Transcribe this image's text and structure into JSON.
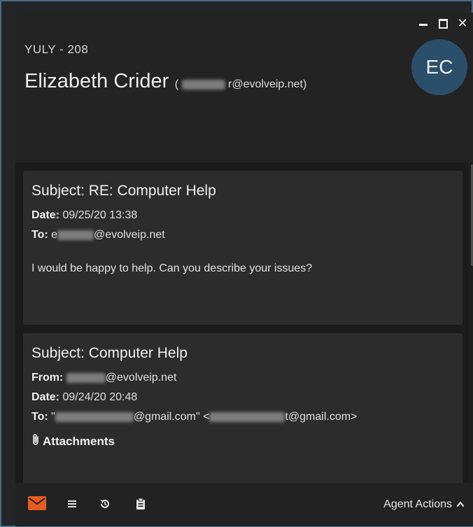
{
  "header": {
    "room": "YULY - 208",
    "contact_name": "Elizabeth Crider",
    "contact_email_prefix": "(",
    "contact_email_suffix": "r@evolveip.net)",
    "avatar_initials": "EC"
  },
  "window_controls": {
    "minimize_icon": "minimize-icon",
    "maximize_icon": "maximize-icon",
    "close_glyph": "✕"
  },
  "emails": [
    {
      "subject": "Subject: RE: Computer Help",
      "date_label": "Date:",
      "date_value": "09/25/20 13:38",
      "to_label": "To:",
      "to_value_prefix": "e",
      "to_value_suffix": "@evolveip.net",
      "body": "I would be happy to help. Can you describe your issues?"
    },
    {
      "subject": "Subject: Computer Help",
      "from_label": "From:",
      "from_value_suffix": "@evolveip.net",
      "date_label": "Date:",
      "date_value": "09/24/20 20:48",
      "to_label": "To:",
      "to_value_prefix": "\"",
      "to_value_mid": "@gmail.com\" <",
      "to_value_suffix": "t@gmail.com>",
      "attachments_label": "Attachments"
    }
  ],
  "toolbar": {
    "icons": [
      "mail-icon",
      "list-icon",
      "history-icon",
      "clipboard-icon"
    ],
    "agent_actions_label": "Agent Actions",
    "agent_actions_chevron": "^",
    "accent_color": "#e35d23"
  }
}
